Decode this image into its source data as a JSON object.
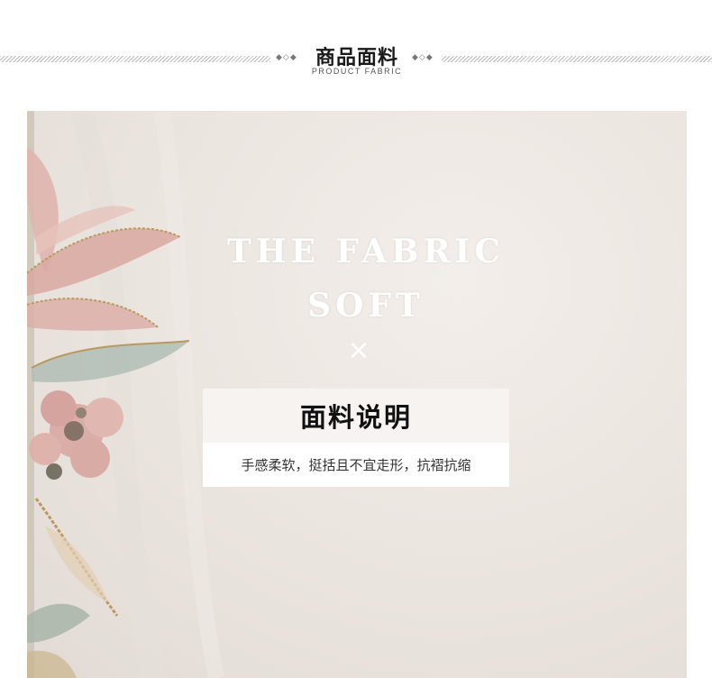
{
  "header": {
    "title_cn": "商品面料",
    "title_en": "PRODUCT FABRIC",
    "ornament": "◆◇◆"
  },
  "banner": {
    "headline_line1": "THE FABRIC",
    "headline_line2": "SOFT",
    "separator": "×",
    "box_title": "面料说明",
    "box_desc": "手感柔软，挺括且不宜走形，抗褶抗缩"
  },
  "colors": {
    "background": "#ffffff",
    "fabric": "#ece6e1",
    "embroidery_pink": "#d9a9a4",
    "embroidery_gold": "#b89a5e",
    "embroidery_sage": "#a9b5a8"
  }
}
